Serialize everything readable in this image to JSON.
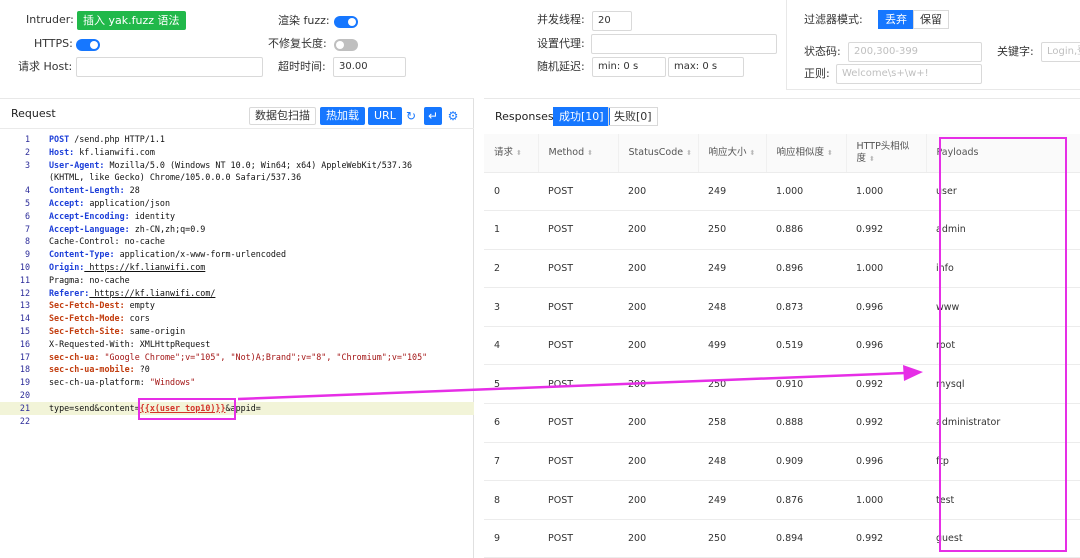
{
  "config": {
    "intruder_label": "Intruder:",
    "insert_btn": "插入 yak.fuzz 语法",
    "https_label": "HTTPS:",
    "host_label": "请求 Host:",
    "host_value": "",
    "render_fuzz_label": "渲染 fuzz:",
    "no_fix_length_label": "不修复长度:",
    "timeout_label": "超时时间:",
    "timeout_value": "30.00",
    "threads_label": "并发线程:",
    "threads_value": "20",
    "proxy_label": "设置代理:",
    "proxy_value": "",
    "delay_label": "随机延迟:",
    "delay_min": "min: 0 s",
    "delay_max": "max: 0 s",
    "toggles": {
      "https": true,
      "render_fuzz": true,
      "no_fix_length": false
    }
  },
  "filter": {
    "mode_label": "过滤器模式:",
    "mode_discard": "丢弃",
    "mode_keep": "保留",
    "status_label": "状态码:",
    "status_placeholder": "200,300-399",
    "keyword_label": "关键字:",
    "keyword_placeholder": "Login,登",
    "regex_label": "正则:",
    "regex_placeholder": "Welcome\\s+\\w+!"
  },
  "request": {
    "title": "Request",
    "btn_scan": "数据包扫描",
    "btn_hotload": "热加载",
    "btn_url": "URL",
    "icons": [
      "history-icon",
      "return-icon",
      "settings-icon"
    ],
    "lines": [
      {
        "n": "1",
        "key": "POST",
        "val": " /send.php HTTP/1.1",
        "style": "blue"
      },
      {
        "n": "2",
        "key": "Host:",
        "val": " kf.lianwifi.com",
        "style": "blue"
      },
      {
        "n": "3",
        "key": "User-Agent:",
        "val": " Mozilla/5.0 (Windows NT 10.0; Win64; x64) AppleWebKit/537.36",
        "style": "blue"
      },
      {
        "n": "",
        "key": "",
        "val": "(KHTML, like Gecko) Chrome/105.0.0.0 Safari/537.36",
        "style": "plain"
      },
      {
        "n": "4",
        "key": "Content-Length:",
        "val": " 28",
        "style": "blue"
      },
      {
        "n": "5",
        "key": "Accept:",
        "val": " application/json",
        "style": "green"
      },
      {
        "n": "6",
        "key": "Accept-Encoding:",
        "val": " identity",
        "style": "green"
      },
      {
        "n": "7",
        "key": "Accept-Language:",
        "val": " zh-CN,zh;q=0.9",
        "style": "green"
      },
      {
        "n": "8",
        "key": "Cache-Control:",
        "val": " no-cache",
        "style": "plain"
      },
      {
        "n": "9",
        "key": "Content-Type:",
        "val": " application/x-www-form-urlencoded",
        "style": "blue"
      },
      {
        "n": "10",
        "key": "Origin:",
        "val": " https://kf.lianwifi.com",
        "style": "blue"
      },
      {
        "n": "11",
        "key": "Pragma:",
        "val": " no-cache",
        "style": "plain"
      },
      {
        "n": "12",
        "key": "Referer:",
        "val": " https://kf.lianwifi.com/",
        "style": "blue"
      },
      {
        "n": "13",
        "key": "Sec-Fetch-Dest:",
        "val": " empty",
        "style": "red"
      },
      {
        "n": "14",
        "key": "Sec-Fetch-Mode:",
        "val": " cors",
        "style": "red"
      },
      {
        "n": "15",
        "key": "Sec-Fetch-Site:",
        "val": " same-origin",
        "style": "red"
      },
      {
        "n": "16",
        "key": "X-Requested-With:",
        "val": " XMLHttpRequest",
        "style": "plain"
      },
      {
        "n": "17",
        "key": "sec-ch-ua:",
        "val": " \"Google Chrome\";v=\"105\", \"Not)A;Brand\";v=\"8\", \"Chromium\";v=\"105\"",
        "style": "red"
      },
      {
        "n": "18",
        "key": "sec-ch-ua-mobile:",
        "val": " ?0",
        "style": "red"
      },
      {
        "n": "19",
        "key": "sec-ch-ua-platform:",
        "val": " \"Windows\"",
        "style": "plain"
      },
      {
        "n": "20",
        "key": "",
        "val": "",
        "style": "plain"
      }
    ],
    "body_line": {
      "n": "21",
      "pre": "type=send&content=",
      "fuzz": "{{x(user_top10)}}",
      "post": "&appid="
    },
    "last_line": {
      "n": "22"
    }
  },
  "responses": {
    "title": "Responses",
    "tab_success": "成功[10]",
    "tab_fail": "失败[0]",
    "columns": [
      "请求",
      "Method",
      "StatusCode",
      "响应大小",
      "响应相似度",
      "HTTP头相似度",
      "Payloads"
    ],
    "rows": [
      [
        "0",
        "POST",
        "200",
        "249",
        "1.000",
        "1.000",
        "user"
      ],
      [
        "1",
        "POST",
        "200",
        "250",
        "0.886",
        "0.992",
        "admin"
      ],
      [
        "2",
        "POST",
        "200",
        "249",
        "0.896",
        "1.000",
        "info"
      ],
      [
        "3",
        "POST",
        "200",
        "248",
        "0.873",
        "0.996",
        "www"
      ],
      [
        "4",
        "POST",
        "200",
        "499",
        "0.519",
        "0.996",
        "root"
      ],
      [
        "5",
        "POST",
        "200",
        "250",
        "0.910",
        "0.992",
        "mysql"
      ],
      [
        "6",
        "POST",
        "200",
        "258",
        "0.888",
        "0.992",
        "administrator"
      ],
      [
        "7",
        "POST",
        "200",
        "248",
        "0.909",
        "0.996",
        "ftp"
      ],
      [
        "8",
        "POST",
        "200",
        "249",
        "0.876",
        "1.000",
        "test"
      ],
      [
        "9",
        "POST",
        "200",
        "250",
        "0.894",
        "0.992",
        "guest"
      ]
    ]
  },
  "colors": {
    "accent": "#1677ff",
    "green_btn": "#21b84a",
    "highlight": "#e62ee6"
  }
}
